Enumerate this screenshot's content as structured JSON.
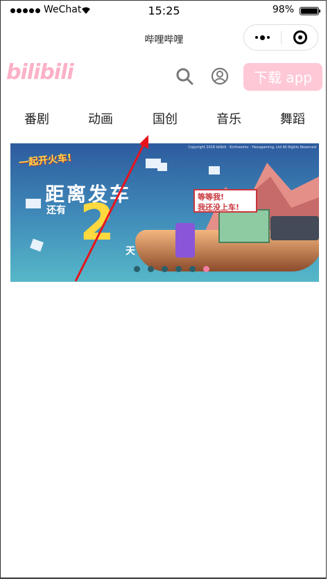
{
  "status_bar": {
    "carrier": "WeChat",
    "time": "15:25",
    "battery": "98%",
    "battery_level": 0.98
  },
  "title_bar": {
    "title": "哔哩哔哩"
  },
  "header": {
    "logo": "bilibili",
    "search_icon": "search-icon",
    "user_icon": "user-icon",
    "download_label": "下载 app"
  },
  "tabs": [
    "番剧",
    "动画",
    "国创",
    "音乐",
    "舞蹈"
  ],
  "banner": {
    "tag": "一起开火车!",
    "headline": "距离发车",
    "still": "还有",
    "count": "2",
    "day": "天",
    "sign_line1": "等等我!",
    "sign_line2": "我还没上车!",
    "copyright": "Copyright 2018 bilibili · Kinfoworks · Hexagaming, Ltd All Rights Reserved",
    "dots_count": 6,
    "active_dot": 5
  },
  "colors": {
    "brand_pink": "#fb7299",
    "download_bg": "#ffc8d6",
    "arrow": "#e8141c"
  }
}
